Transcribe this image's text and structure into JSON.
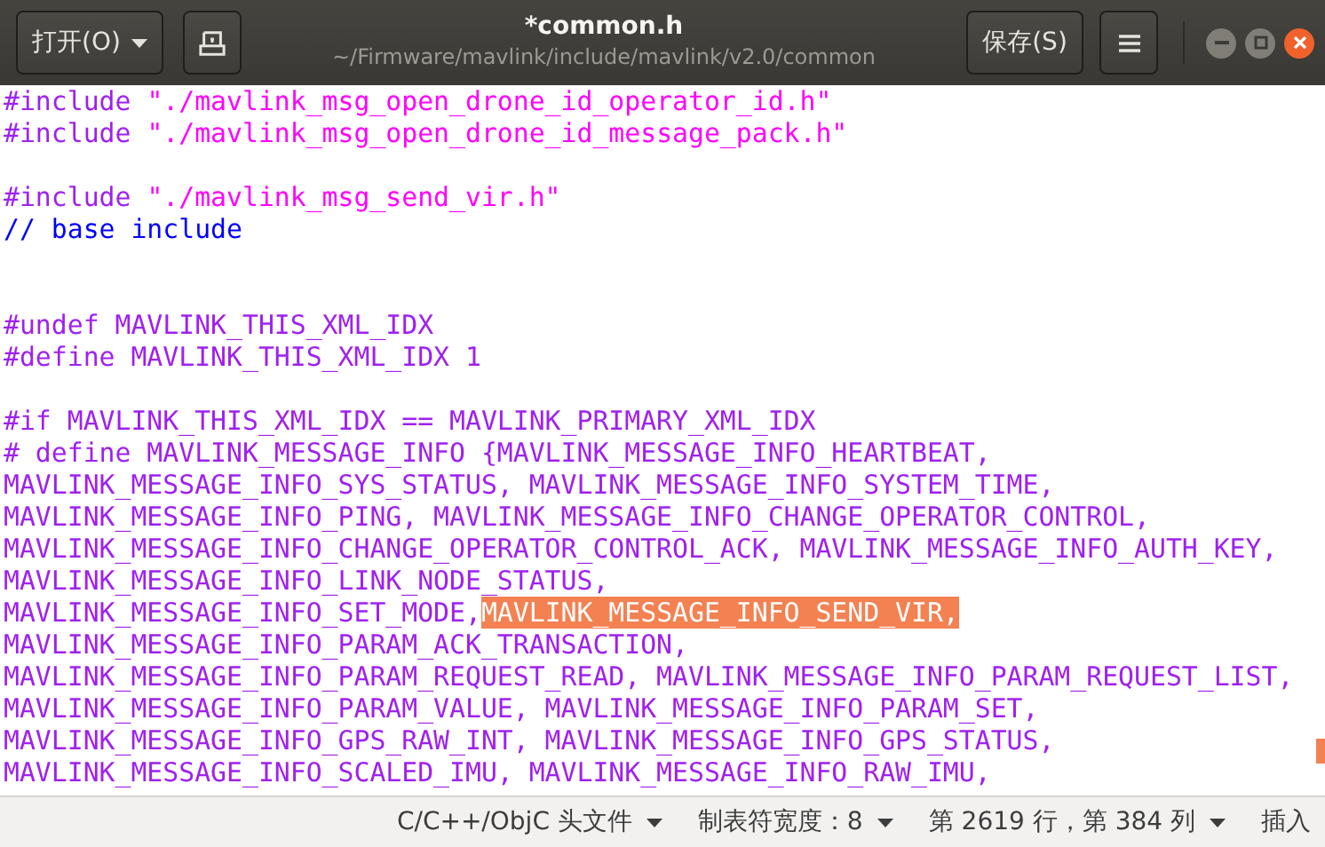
{
  "window": {
    "title": "*common.h",
    "subtitle": "~/Firmware/mavlink/include/mavlink/v2.0/common"
  },
  "header": {
    "open_button": "打开(O)",
    "save_button": "保存(S)"
  },
  "editor": {
    "lines": [
      {
        "kind": "code",
        "segments": [
          {
            "kind": "preproc",
            "text": "#include ",
            "selected": false
          },
          {
            "kind": "string",
            "text": "\"./mavlink_msg_open_drone_id_operator_id.h\"",
            "selected": false
          }
        ]
      },
      {
        "kind": "code",
        "segments": [
          {
            "kind": "preproc",
            "text": "#include ",
            "selected": false
          },
          {
            "kind": "string",
            "text": "\"./mavlink_msg_open_drone_id_message_pack.h\"",
            "selected": false
          }
        ]
      },
      {
        "kind": "blank"
      },
      {
        "kind": "code",
        "segments": [
          {
            "kind": "preproc",
            "text": "#include ",
            "selected": false
          },
          {
            "kind": "string",
            "text": "\"./mavlink_msg_send_vir.h\"",
            "selected": false
          }
        ]
      },
      {
        "kind": "code",
        "segments": [
          {
            "kind": "comment",
            "text": "// base include",
            "selected": false
          }
        ]
      },
      {
        "kind": "blank"
      },
      {
        "kind": "blank"
      },
      {
        "kind": "code",
        "segments": [
          {
            "kind": "preproc",
            "text": "#undef MAVLINK_THIS_XML_IDX",
            "selected": false
          }
        ]
      },
      {
        "kind": "code",
        "segments": [
          {
            "kind": "preproc",
            "text": "#define MAVLINK_THIS_XML_IDX 1",
            "selected": false
          }
        ]
      },
      {
        "kind": "blank"
      },
      {
        "kind": "code",
        "segments": [
          {
            "kind": "preproc",
            "text": "#if MAVLINK_THIS_XML_IDX == MAVLINK_PRIMARY_XML_IDX",
            "selected": false
          }
        ]
      },
      {
        "kind": "code",
        "segments": [
          {
            "kind": "preproc",
            "text": "# define MAVLINK_MESSAGE_INFO {MAVLINK_MESSAGE_INFO_HEARTBEAT,",
            "selected": false
          }
        ]
      },
      {
        "kind": "code",
        "segments": [
          {
            "kind": "preproc",
            "text": "MAVLINK_MESSAGE_INFO_SYS_STATUS, MAVLINK_MESSAGE_INFO_SYSTEM_TIME,",
            "selected": false
          }
        ]
      },
      {
        "kind": "code",
        "segments": [
          {
            "kind": "preproc",
            "text": "MAVLINK_MESSAGE_INFO_PING, MAVLINK_MESSAGE_INFO_CHANGE_OPERATOR_CONTROL,",
            "selected": false
          }
        ]
      },
      {
        "kind": "code",
        "segments": [
          {
            "kind": "preproc",
            "text": "MAVLINK_MESSAGE_INFO_CHANGE_OPERATOR_CONTROL_ACK, MAVLINK_MESSAGE_INFO_AUTH_KEY,",
            "selected": false
          }
        ]
      },
      {
        "kind": "code",
        "segments": [
          {
            "kind": "preproc",
            "text": "MAVLINK_MESSAGE_INFO_LINK_NODE_STATUS,",
            "selected": false
          }
        ]
      },
      {
        "kind": "code",
        "segments": [
          {
            "kind": "preproc",
            "text": "MAVLINK_MESSAGE_INFO_SET_MODE,",
            "selected": false
          },
          {
            "kind": "preproc",
            "text": "MAVLINK_MESSAGE_INFO_SEND_VIR,",
            "selected": true
          }
        ]
      },
      {
        "kind": "code",
        "segments": [
          {
            "kind": "preproc",
            "text": "MAVLINK_MESSAGE_INFO_PARAM_ACK_TRANSACTION,",
            "selected": false
          }
        ]
      },
      {
        "kind": "code",
        "segments": [
          {
            "kind": "preproc",
            "text": "MAVLINK_MESSAGE_INFO_PARAM_REQUEST_READ, MAVLINK_MESSAGE_INFO_PARAM_REQUEST_LIST,",
            "selected": false
          }
        ]
      },
      {
        "kind": "code",
        "segments": [
          {
            "kind": "preproc",
            "text": "MAVLINK_MESSAGE_INFO_PARAM_VALUE, MAVLINK_MESSAGE_INFO_PARAM_SET,",
            "selected": false
          }
        ]
      },
      {
        "kind": "code",
        "segments": [
          {
            "kind": "preproc",
            "text": "MAVLINK_MESSAGE_INFO_GPS_RAW_INT, MAVLINK_MESSAGE_INFO_GPS_STATUS,",
            "selected": false
          }
        ]
      },
      {
        "kind": "code",
        "segments": [
          {
            "kind": "preproc",
            "text": "MAVLINK_MESSAGE_INFO_SCALED_IMU, MAVLINK_MESSAGE_INFO_RAW_IMU,",
            "selected": false
          }
        ]
      }
    ]
  },
  "status_bar": {
    "items": [
      {
        "kind": "dropdown",
        "label": "C/C++/ObjC 头文件"
      },
      {
        "kind": "dropdown",
        "label": "制表符宽度：8"
      },
      {
        "kind": "dropdown",
        "label": "第 2619 行，第 384 列"
      },
      {
        "kind": "text",
        "label": "插入"
      }
    ]
  }
}
